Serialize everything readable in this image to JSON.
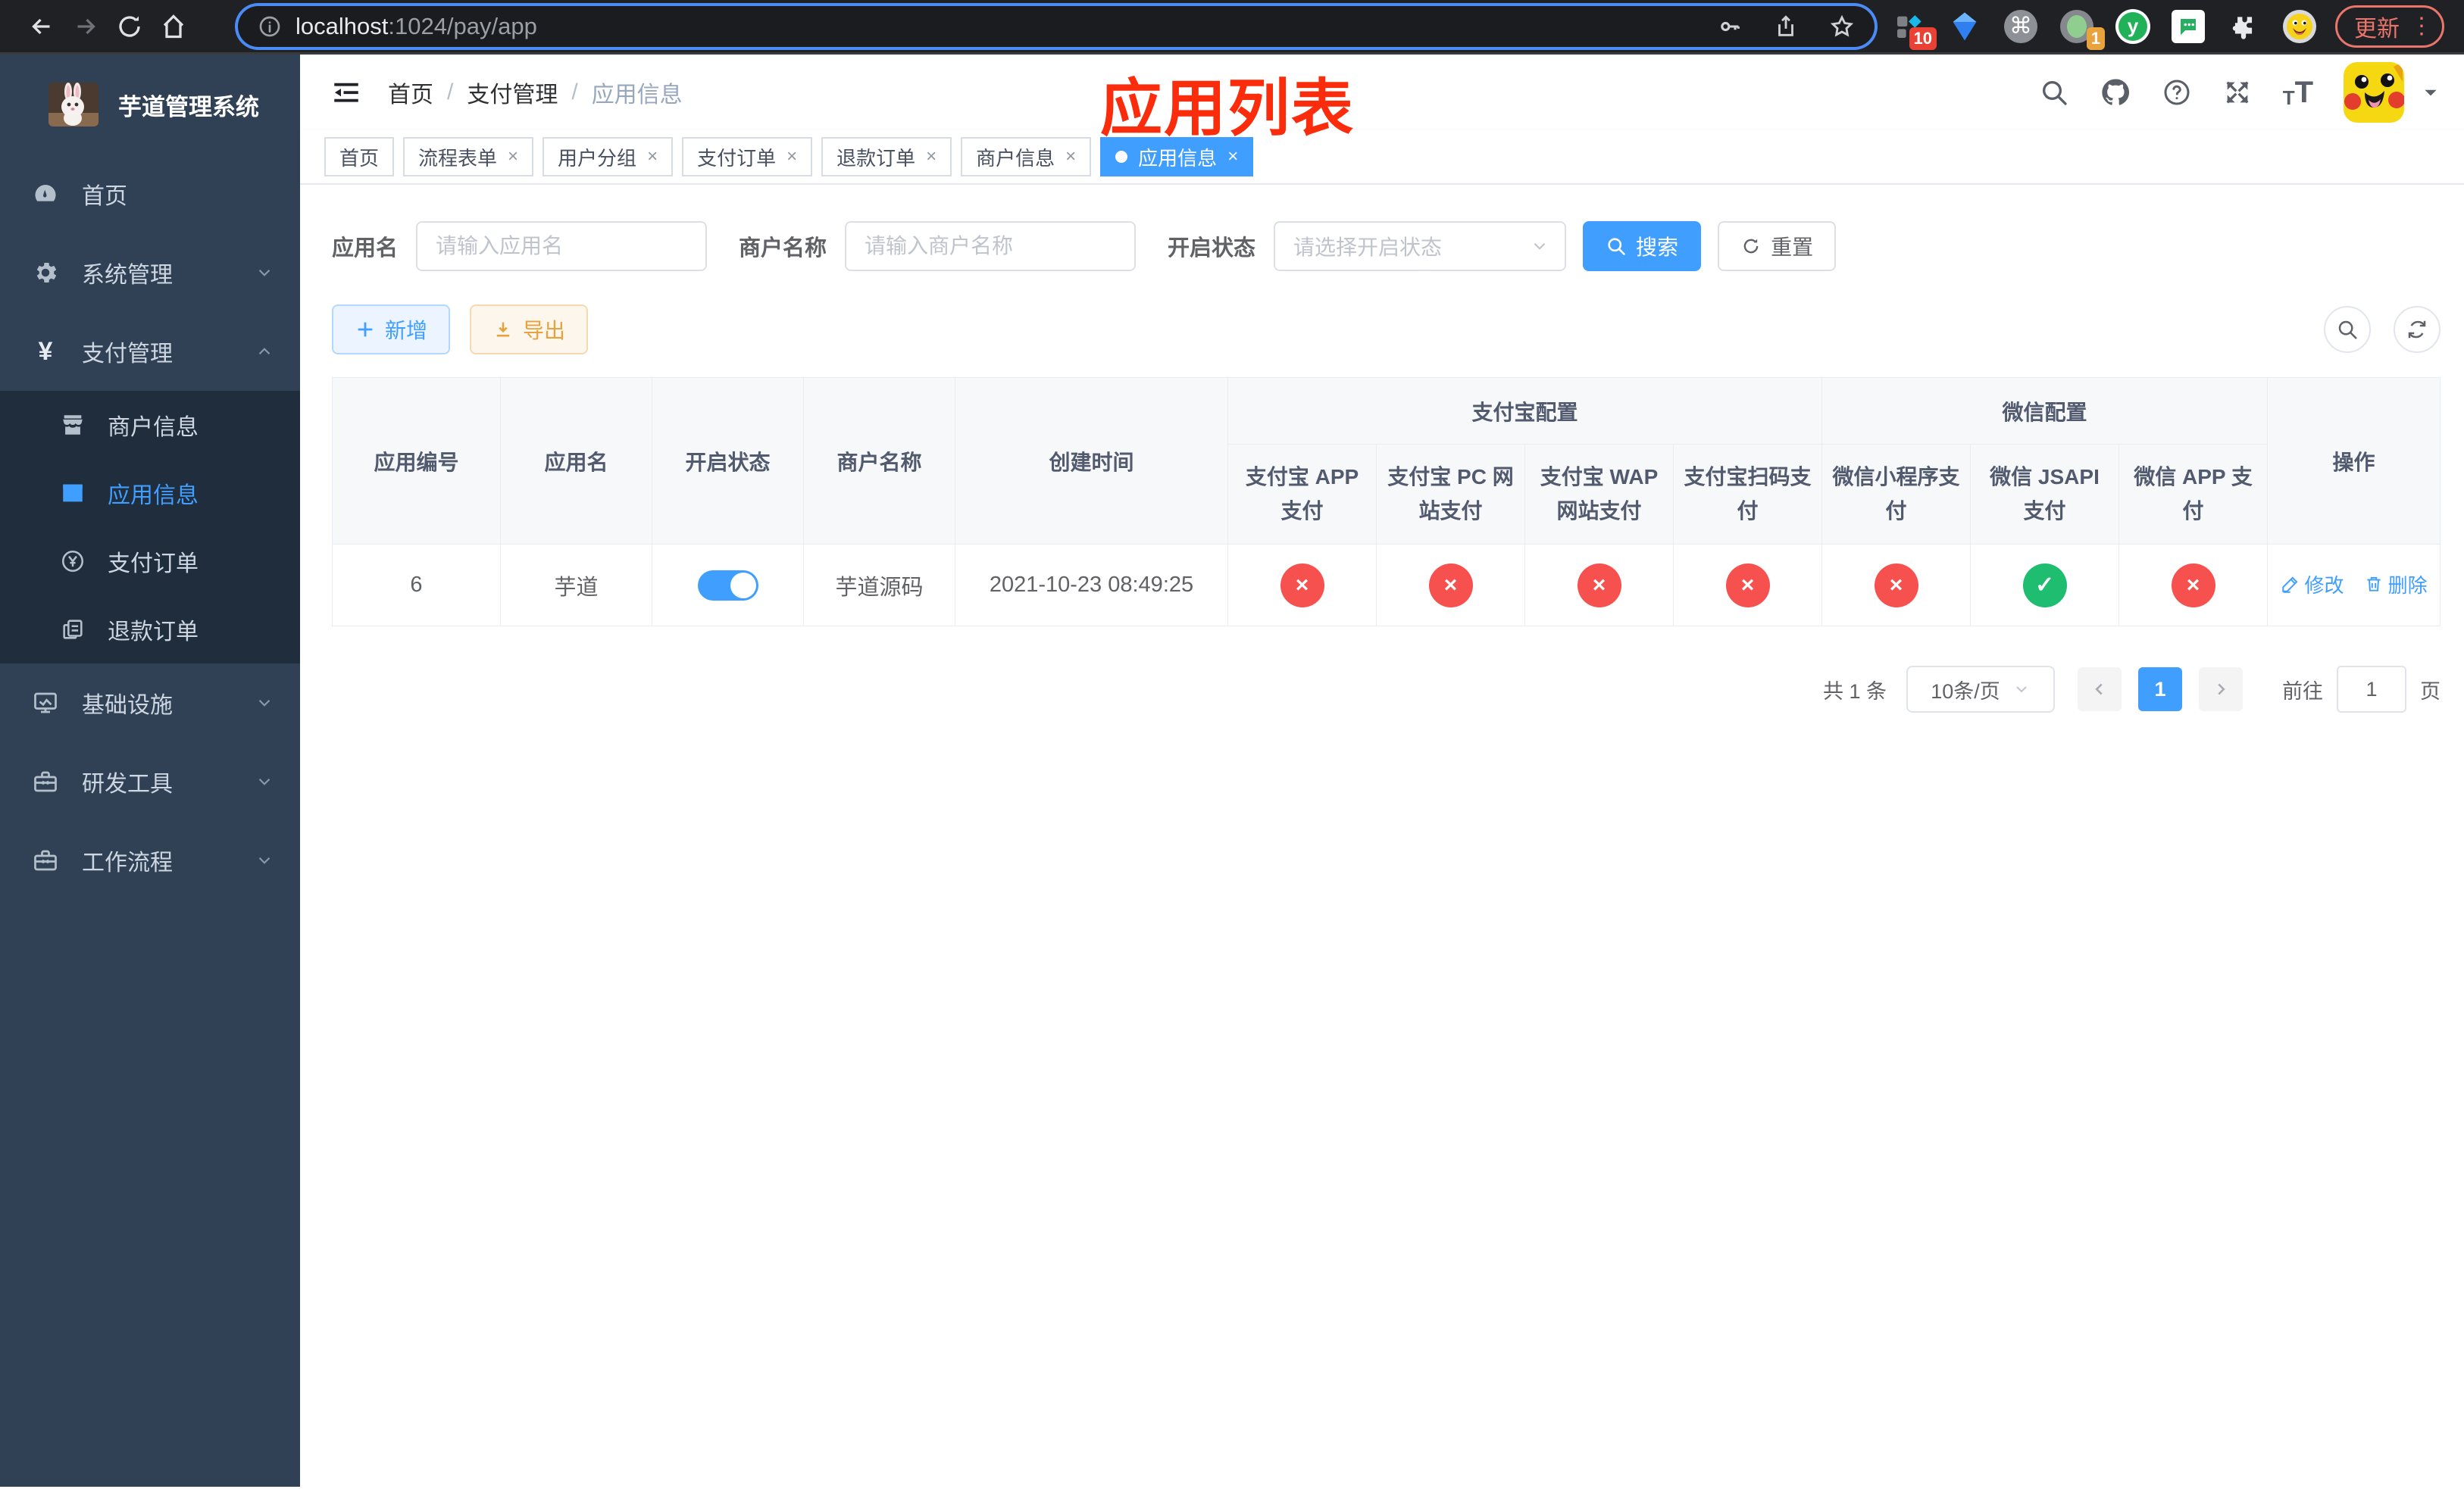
{
  "browser": {
    "url_host": "localhost",
    "url_rest": ":1024/pay/app",
    "update_label": "更新",
    "kebab": "⋮",
    "ext_badge_10": "10",
    "ext_badge_1": "1",
    "ext_y_letter": "y",
    "cmd_glyph": "⌘"
  },
  "sidebar": {
    "title": "芋道管理系统",
    "menu_home": "首页",
    "menu_system": "系统管理",
    "menu_pay": "支付管理",
    "sub_merchant": "商户信息",
    "sub_app": "应用信息",
    "sub_order": "支付订单",
    "sub_refund": "退款订单",
    "menu_infra": "基础设施",
    "menu_dev": "研发工具",
    "menu_flow": "工作流程"
  },
  "navbar": {
    "breadcrumb": [
      "首页",
      "支付管理",
      "应用信息"
    ],
    "separator": "/",
    "annotation": "应用列表"
  },
  "tabs": [
    {
      "label": "首页"
    },
    {
      "label": "流程表单"
    },
    {
      "label": "用户分组"
    },
    {
      "label": "支付订单"
    },
    {
      "label": "退款订单"
    },
    {
      "label": "商户信息"
    },
    {
      "label": "应用信息"
    }
  ],
  "tab_close": "×",
  "filters": {
    "app_name_label": "应用名",
    "app_name_placeholder": "请输入应用名",
    "merchant_label": "商户名称",
    "merchant_placeholder": "请输入商户名称",
    "status_label": "开启状态",
    "status_placeholder": "请选择开启状态",
    "search_label": "搜索",
    "reset_label": "重置"
  },
  "actions": {
    "add_label": "新增",
    "export_label": "导出"
  },
  "table": {
    "headers": {
      "app_id": "应用编号",
      "app_name": "应用名",
      "status": "开启状态",
      "merchant": "商户名称",
      "created": "创建时间",
      "alipay_group": "支付宝配置",
      "wechat_group": "微信配置",
      "ops": "操作",
      "channels": [
        "支付宝 APP 支付",
        "支付宝 PC 网站支付",
        "支付宝 WAP 网站支付",
        "支付宝扫码支付",
        "微信小程序支付",
        "微信 JSAPI 支付",
        "微信 APP 支付"
      ]
    },
    "row": {
      "app_id": "6",
      "app_name": "芋道",
      "status_on": true,
      "merchant": "芋道源码",
      "created": "2021-10-23 08:49:25",
      "channels": [
        {
          "glyph": "×",
          "cls": "st fail"
        },
        {
          "glyph": "×",
          "cls": "st fail"
        },
        {
          "glyph": "×",
          "cls": "st fail"
        },
        {
          "glyph": "×",
          "cls": "st fail"
        },
        {
          "glyph": "×",
          "cls": "st fail"
        },
        {
          "glyph": "✓",
          "cls": "st ok"
        },
        {
          "glyph": "×",
          "cls": "st fail"
        }
      ],
      "edit_label": "修改",
      "delete_label": "删除"
    }
  },
  "pagination": {
    "total": "共 1 条",
    "page_size": "10条/页",
    "current_page": "1",
    "goto_label": "前往",
    "goto_value": "1",
    "page_unit": "页"
  }
}
